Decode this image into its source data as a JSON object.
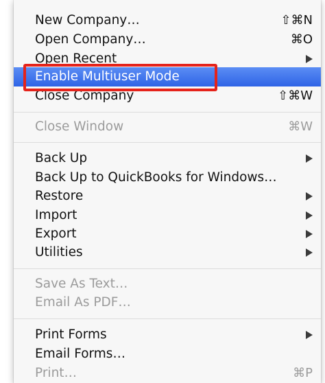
{
  "menu": {
    "items": [
      {
        "label": "New Company…",
        "shortcut": "⇧⌘N"
      },
      {
        "label": "Open Company…",
        "shortcut": "⌘O"
      },
      {
        "label": "Open Recent",
        "submenu_icon": "chevron-right-icon"
      },
      {
        "label": "Enable Multiuser Mode",
        "state": "highlighted"
      },
      {
        "label": "Close Company",
        "shortcut": "⇧⌘W"
      },
      {
        "label": "Close Window",
        "shortcut": "⌘W",
        "state": "disabled"
      },
      {
        "label": "Back Up",
        "submenu_icon": "chevron-right-icon"
      },
      {
        "label": "Back Up to QuickBooks for Windows…"
      },
      {
        "label": "Restore",
        "submenu_icon": "chevron-right-icon"
      },
      {
        "label": "Import",
        "submenu_icon": "chevron-right-icon"
      },
      {
        "label": "Export",
        "submenu_icon": "chevron-right-icon"
      },
      {
        "label": "Utilities",
        "submenu_icon": "chevron-right-icon"
      },
      {
        "label": "Save As Text…",
        "state": "disabled"
      },
      {
        "label": "Email As PDF…",
        "state": "disabled"
      },
      {
        "label": "Print Forms",
        "submenu_icon": "chevron-right-icon"
      },
      {
        "label": "Email Forms…"
      },
      {
        "label": "Print…",
        "shortcut": "⌘P",
        "state": "disabled"
      }
    ]
  },
  "colors": {
    "highlight": "#3b74ee",
    "callout": "#e5231b",
    "disabled_text": "#9b9b9b"
  }
}
